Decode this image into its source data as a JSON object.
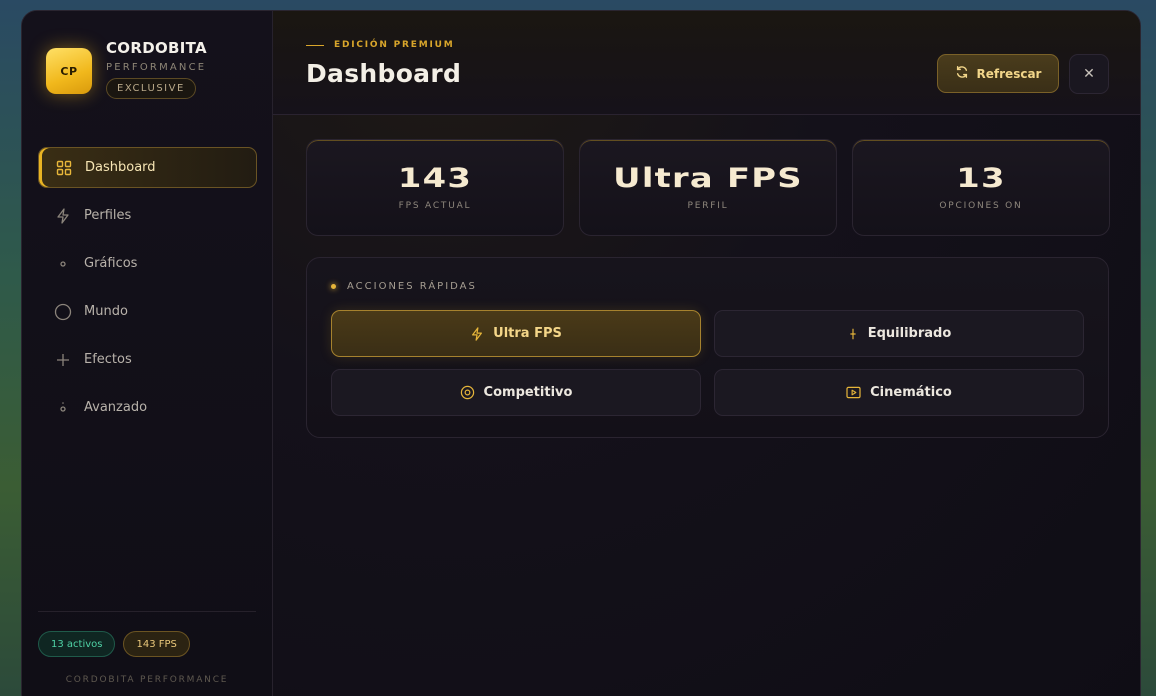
{
  "brand": {
    "logo_text": "CP",
    "name": "CORDOBITA",
    "subtitle": "PERFORMANCE",
    "badge": "EXCLUSIVE"
  },
  "sidebar": {
    "items": [
      {
        "label": "Dashboard",
        "icon": "grid-icon",
        "active": true
      },
      {
        "label": "Perfiles",
        "icon": "bolt-icon",
        "active": false
      },
      {
        "label": "Gráficos",
        "icon": "dot-icon",
        "active": false
      },
      {
        "label": "Mundo",
        "icon": "circle-icon",
        "active": false
      },
      {
        "label": "Efectos",
        "icon": "plus-icon",
        "active": false
      },
      {
        "label": "Avanzado",
        "icon": "dot-icon",
        "active": false
      }
    ],
    "pills": {
      "active_count": "13 activos",
      "fps": "143 FPS"
    },
    "footer": "CORDOBITA PERFORMANCE"
  },
  "header": {
    "eyebrow": "EDICIÓN PREMIUM",
    "title": "Dashboard",
    "refresh_label": "Refrescar",
    "close_symbol": "✕"
  },
  "stats": [
    {
      "value": "143",
      "label": "FPS ACTUAL"
    },
    {
      "value": "Ultra FPS",
      "label": "PERFIL"
    },
    {
      "value": "13",
      "label": "OPCIONES ON"
    }
  ],
  "quick_actions": {
    "title": "ACCIONES RÁPIDAS",
    "buttons": [
      {
        "label": "Ultra FPS",
        "icon": "bolt-icon",
        "active": true
      },
      {
        "label": "Equilibrado",
        "icon": "balance-icon",
        "active": false
      },
      {
        "label": "Competitivo",
        "icon": "target-icon",
        "active": false
      },
      {
        "label": "Cinemático",
        "icon": "film-icon",
        "active": false
      }
    ]
  },
  "colors": {
    "accent": "#e6b53a",
    "background": "#0f0d16",
    "success": "#4fd1a5"
  }
}
